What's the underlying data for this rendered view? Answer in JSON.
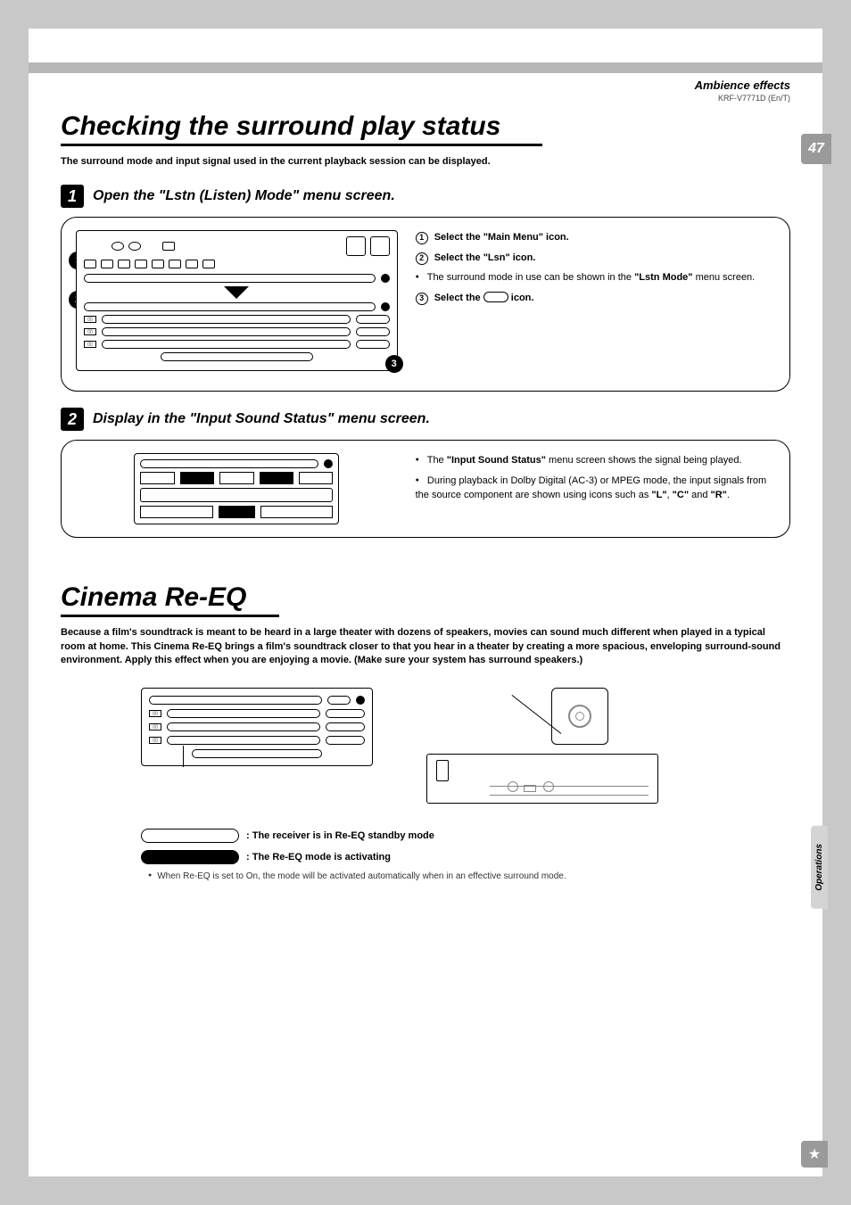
{
  "header": {
    "section": "Ambience effects",
    "model": "KRF-V7771D (En/T)",
    "page_number": "47"
  },
  "title1": "Checking the surround play status",
  "lead1": "The surround mode and input signal used in the current playback session can be displayed.",
  "step1": {
    "title": "Open the \"Lstn (Listen) Mode\" menu screen.",
    "r1": "Select the \"Main Menu\" icon.",
    "r2": "Select the \"Lsn\" icon.",
    "note_a": "The surround mode in use can be shown in the ",
    "note_b": "\"Lstn Mode\"",
    "note_c": " menu screen.",
    "r3_a": "Select the ",
    "r3_b": " icon."
  },
  "step2": {
    "title": "Display in the \"Input Sound Status\" menu screen.",
    "note1_a": "The ",
    "note1_b": "\"Input Sound Status\"",
    "note1_c": " menu screen shows the signal being played.",
    "note2_a": "During playback in Dolby Digital (AC-3) or MPEG mode, the input signals from the source component are shown using icons such as ",
    "note2_b": "\"L\"",
    "note2_c": ", ",
    "note2_d": "\"C\"",
    "note2_e": " and ",
    "note2_f": "\"R\"",
    "note2_g": "."
  },
  "title2": "Cinema Re-EQ",
  "lead2": "Because a film's soundtrack is meant to be heard in a large theater with dozens of speakers, movies can sound much different when played in a typical room at home.  This Cinema Re-EQ brings a film's soundtrack closer to that you hear in a theater by creating a more spacious, enveloping surround-sound environment.  Apply this effect when you are enjoying a movie.  (Make sure your system has surround speakers.)",
  "legend": {
    "standby": ": The receiver is in Re-EQ standby mode",
    "active": ": The Re-EQ mode is activating",
    "note": "When Re-EQ is set to On, the mode will be activated automatically when in an effective surround mode."
  },
  "side_tab": "Operations",
  "labels": {
    "num1": "1",
    "num2": "2",
    "num3": "3",
    "dd": "▯▯"
  }
}
